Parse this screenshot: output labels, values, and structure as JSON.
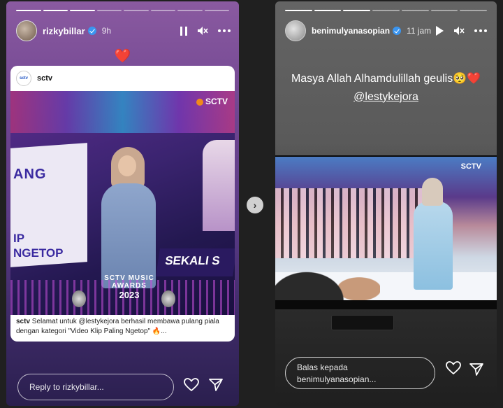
{
  "left_story": {
    "username": "rizkybillar",
    "time": "9h",
    "heart_emoji": "❤️",
    "post": {
      "account": "sctv",
      "avatar_text": "sctv",
      "image_texts": {
        "banner_1": "ANG",
        "banner_2": "IP\nNGETOP",
        "sekali": "SEKALI S",
        "award_title": "SCTV MUSIC AWARDS",
        "award_year": "2023",
        "channel_logo": "SCTV"
      },
      "caption_user": "sctv",
      "caption_text": " Selamat untuk @lestykejora berhasil membawa pulang piala dengan kategori \"Video Klip Paling Ngetop\" 🔥..."
    },
    "reply_placeholder": "Reply to rizkybillar..."
  },
  "right_story": {
    "username": "benimulyanasopian",
    "time": "11 jam",
    "message_line1": "Masya Allah Alhamdulillah geulis🥺❤️",
    "mention": "@lestykejora",
    "tv_logo": "SCTV",
    "reply_placeholder": "Balas kepada benimulyanasopian..."
  },
  "icons": {
    "pause": "pause-icon",
    "mute": "mute-icon",
    "more": "more-icon",
    "play": "play-icon",
    "heart": "heart-outline-icon",
    "send": "send-icon",
    "next": "chevron-right-icon"
  },
  "colors": {
    "verified": "#3a95f0",
    "heart": "#e0102a"
  }
}
